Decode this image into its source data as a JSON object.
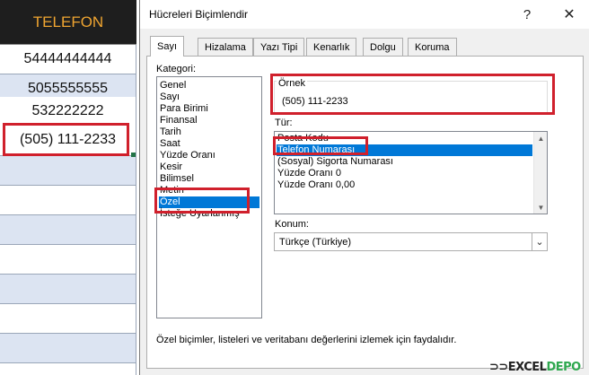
{
  "sheet": {
    "header": "TELEFON",
    "cells": [
      "54444444444",
      "5055555555",
      "532222222",
      "(505) 111-2233",
      "",
      "",
      "",
      "",
      "",
      "",
      "",
      ""
    ]
  },
  "dialog": {
    "title": "Hücreleri Biçimlendir",
    "help_glyph": "?",
    "close_glyph": "✕",
    "tabs": [
      "Sayı",
      "Hizalama",
      "Yazı Tipi",
      "Kenarlık",
      "Dolgu",
      "Koruma"
    ],
    "active_tab": "Sayı",
    "category_label": "Kategori:",
    "categories": [
      "Genel",
      "Sayı",
      "Para Birimi",
      "Finansal",
      "Tarih",
      "Saat",
      "Yüzde Oranı",
      "Kesir",
      "Bilimsel",
      "Metin",
      "Özel",
      "İsteğe Uyarlanmış"
    ],
    "selected_category": "Özel",
    "sample_label": "Örnek",
    "sample_value": "(505) 111-2233",
    "type_label": "Tür:",
    "types": [
      "Posta Kodu",
      "Telefon Numarası",
      "(Sosyal) Sigorta Numarası",
      "Yüzde Oranı 0",
      "Yüzde Oranı 0,00"
    ],
    "selected_type": "Telefon Numarası",
    "locale_label": "Konum:",
    "locale_value": "Türkçe (Türkiye)",
    "description": "Özel biçimler, listeleri ve veritabanı değerlerini izlemek için faydalıdır.",
    "icons": {
      "help": "help-icon",
      "close": "close-icon",
      "scroll_up": "chevron-up-icon",
      "scroll_down": "chevron-down-icon",
      "dropdown": "chevron-down-icon"
    }
  },
  "watermark": {
    "part1": "EXCEL",
    "part2": "DEPO",
    "prefix": "⊃⊃"
  },
  "colors": {
    "highlight": "#d0202c",
    "selection": "#0078d7",
    "header_text": "#f0a531",
    "alt_row": "#dce4f2"
  }
}
